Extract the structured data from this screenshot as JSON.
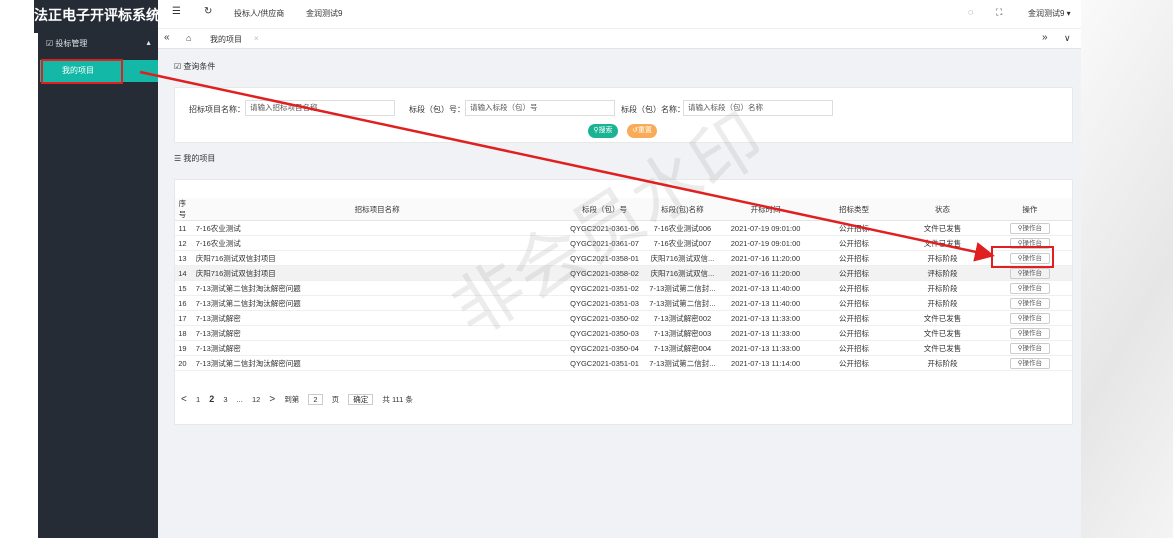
{
  "sidebar": {
    "brand": "法正电子开评标系统",
    "group_label": "投标管理",
    "item_label": "我的项目"
  },
  "topbar": {
    "role_label": "投标人/供应商",
    "user_label": "金润测试9",
    "account_label": "金润测试9 ▾"
  },
  "tabs": {
    "active_tab": "我的项目"
  },
  "query": {
    "section_title": "查询条件",
    "project_name_label": "招标项目名称：",
    "project_name_placeholder": "请输入招标项目名称",
    "section_no_label": "标段（包）号：",
    "section_no_placeholder": "请输入标段（包）号",
    "section_name_label": "标段（包）名称：",
    "section_name_placeholder": "请输入标段（包）名称",
    "search_button": "搜索",
    "reset_button": "重置"
  },
  "list": {
    "section_title": "我的项目",
    "columns": [
      "序号",
      "招标项目名称",
      "标段（包）号",
      "标段(包)名称",
      "开标时间",
      "招标类型",
      "状态",
      "操作"
    ],
    "op_label": "操作台",
    "rows": [
      {
        "no": "11",
        "name": "7-16农业测试",
        "code": "QYGC2021-0361-06",
        "section": "7-16农业测试006",
        "time": "2021-07-19 09:01:00",
        "type": "公开招标",
        "status": "文件已发售"
      },
      {
        "no": "12",
        "name": "7-16农业测试",
        "code": "QYGC2021-0361-07",
        "section": "7-16农业测试007",
        "time": "2021-07-19 09:01:00",
        "type": "公开招标",
        "status": "文件已发售"
      },
      {
        "no": "13",
        "name": "庆阳716测试双信封项目",
        "code": "QYGC2021-0358-01",
        "section": "庆阳716测试双信...",
        "time": "2021-07-16 11:20:00",
        "type": "公开招标",
        "status": "开标阶段"
      },
      {
        "no": "14",
        "name": "庆阳716测试双信封项目",
        "code": "QYGC2021-0358-02",
        "section": "庆阳716测试双信...",
        "time": "2021-07-16 11:20:00",
        "type": "公开招标",
        "status": "评标阶段"
      },
      {
        "no": "15",
        "name": "7-13测试第二信封淘汰解密问题",
        "code": "QYGC2021-0351-02",
        "section": "7-13测试第二信封...",
        "time": "2021-07-13 11:40:00",
        "type": "公开招标",
        "status": "开标阶段"
      },
      {
        "no": "16",
        "name": "7-13测试第二信封淘汰解密问题",
        "code": "QYGC2021-0351-03",
        "section": "7-13测试第二信封...",
        "time": "2021-07-13 11:40:00",
        "type": "公开招标",
        "status": "开标阶段"
      },
      {
        "no": "17",
        "name": "7-13测试解密",
        "code": "QYGC2021-0350-02",
        "section": "7-13测试解密002",
        "time": "2021-07-13 11:33:00",
        "type": "公开招标",
        "status": "文件已发售"
      },
      {
        "no": "18",
        "name": "7-13测试解密",
        "code": "QYGC2021-0350-03",
        "section": "7-13测试解密003",
        "time": "2021-07-13 11:33:00",
        "type": "公开招标",
        "status": "文件已发售"
      },
      {
        "no": "19",
        "name": "7-13测试解密",
        "code": "QYGC2021-0350-04",
        "section": "7-13测试解密004",
        "time": "2021-07-13 11:33:00",
        "type": "公开招标",
        "status": "文件已发售"
      },
      {
        "no": "20",
        "name": "7-13测试第二信封淘汰解密问题",
        "code": "QYGC2021-0351-01",
        "section": "7-13测试第二信封...",
        "time": "2021-07-13 11:14:00",
        "type": "公开招标",
        "status": "开标阶段"
      }
    ]
  },
  "pager": {
    "prev": "<",
    "p1": "1",
    "p2": "2",
    "p3": "3",
    "ellipsis": "...",
    "p12": "12",
    "next": ">",
    "goto_label": "到第",
    "goto_value": "2",
    "page_unit": "页",
    "confirm": "确定",
    "total": "共 111 条"
  },
  "watermark": "非会员水印",
  "colors": {
    "sidebar_bg": "#262c35",
    "accent": "#14b8a6",
    "search_btn": "#1ab394",
    "reset_btn": "#f8ac59",
    "annotation": "#e02020"
  }
}
